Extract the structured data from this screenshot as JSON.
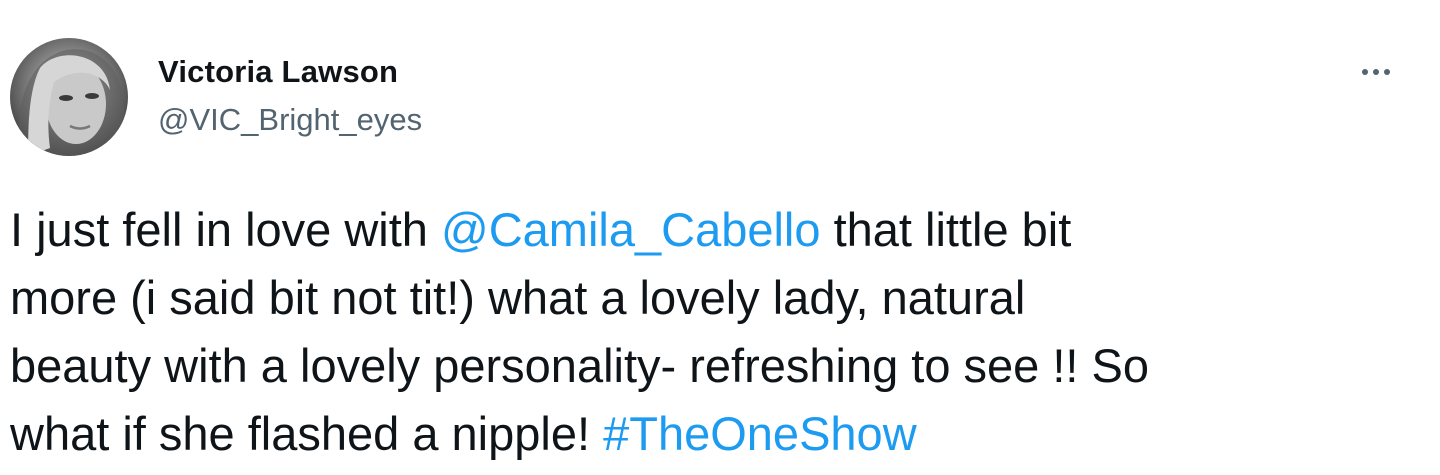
{
  "tweet": {
    "author": {
      "name": "Victoria Lawson",
      "handle": "@VIC_Bright_eyes",
      "avatar_icon": "profile-photo"
    },
    "more_icon": "ellipsis-icon",
    "body": {
      "line1_pre": "I just fell in love with ",
      "mention": "@Camila_Cabello",
      "line1_post": " that little bit",
      "line2": "more (i said bit not tit!) what a lovely lady, natural",
      "line3": "beauty with a lovely personality- refreshing to see !! So",
      "line4_pre": "what if she flashed a nipple! ",
      "hashtag": "#TheOneShow"
    },
    "colors": {
      "text": "#0f1419",
      "secondary": "#536471",
      "link": "#1d9bf0"
    }
  }
}
